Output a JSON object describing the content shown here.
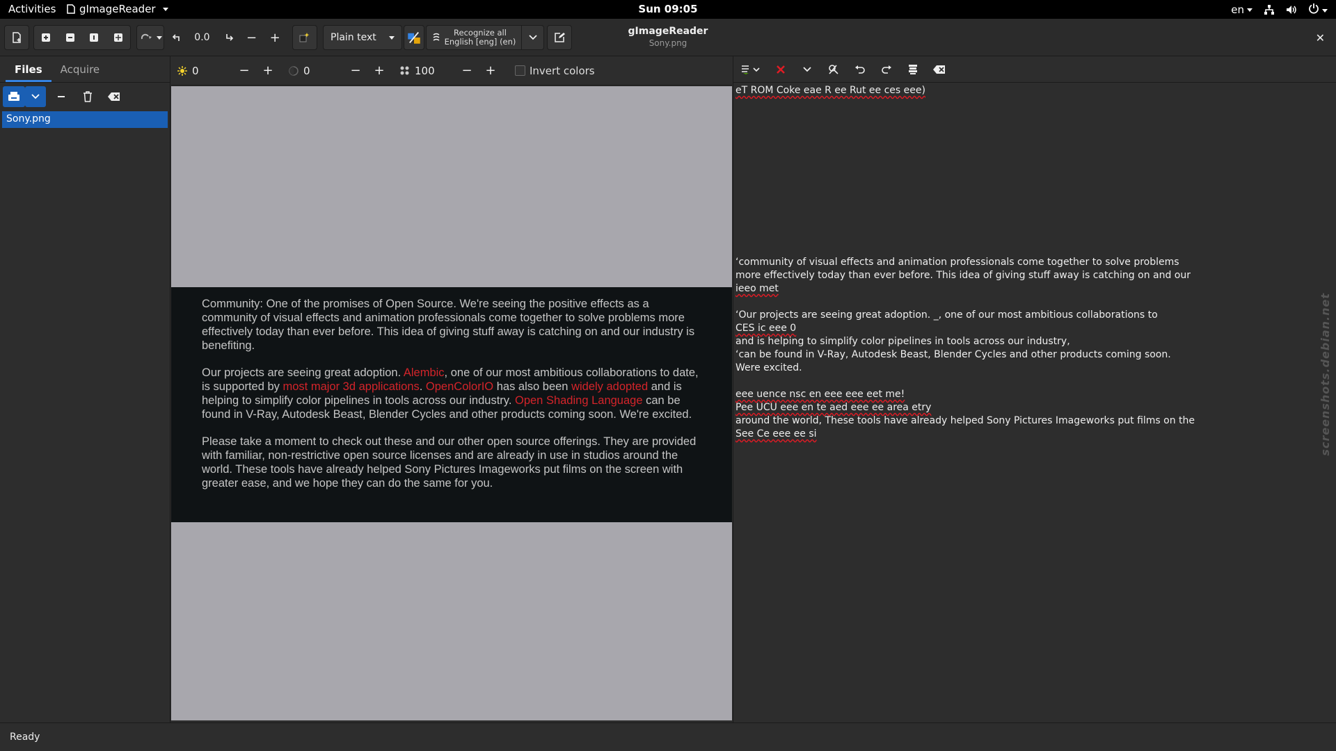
{
  "topbar": {
    "activities": "Activities",
    "app_name": "gImageReader",
    "clock": "Sun 09:05",
    "lang": "en"
  },
  "header": {
    "angle_value": "0.0",
    "output_mode": "Plain text",
    "recognize_line1": "Recognize all",
    "recognize_line2": "English [eng] (en)",
    "title": "gImageReader",
    "subtitle": "Sony.png",
    "close": "✕"
  },
  "left": {
    "tabs": [
      {
        "label": "Files"
      },
      {
        "label": "Acquire"
      }
    ],
    "files": [
      {
        "name": "Sony.png"
      }
    ]
  },
  "mid": {
    "brightness": "0",
    "contrast": "0",
    "resolution": "100",
    "minus": "−",
    "plus": "+",
    "invert_label": "Invert colors"
  },
  "doc": {
    "p1": "Community: One of the promises of Open Source. We're seeing the positive effects as a community of visual effects and animation professionals come together to solve problems more effectively today than ever before. This idea of giving stuff away is catching on and our industry is benefiting.",
    "p2_a": "Our projects are seeing great adoption. ",
    "p2_link1": "Alembic",
    "p2_b": ", one of our most ambitious collaborations to date, is supported by ",
    "p2_link2": "most major 3d applications",
    "p2_c": ". ",
    "p2_link3": "OpenColorIO",
    "p2_d": " has also been ",
    "p2_link4": "widely adopted",
    "p2_e": " and is helping to simplify color pipelines in tools across our industry. ",
    "p2_link5": "Open Shading Language",
    "p2_f": " can be found in V-Ray, Autodesk Beast, Blender Cycles and other products coming soon. We're excited.",
    "p3": "Please take a moment to check out these and our other open source offerings. They are provided with familiar, non-restrictive open source licenses and are already in use in studios around the world. These tools have already helped Sony Pictures Imageworks put films on the screen with greater ease, and we hope they can do the same for you."
  },
  "ocr": {
    "l1": "eT ROM Coke eae R ee Rut ee ces eee)",
    "l2": "‘community of visual effects and animation professionals come together to solve problems",
    "l3": "more effectively today than ever before. This idea of giving stuff away is catching on and our",
    "l4": "ieeo met",
    "l5": "‘Our projects are seeing great adoption. _, one of our most ambitious collaborations to",
    "l6": "CES ic eee 0",
    "l7": "and is helping to simplify color pipelines in tools across our industry,",
    "l8": "‘can be found in V-Ray, Autodesk Beast, Blender Cycles and other products coming soon.",
    "l9": "Were excited.",
    "l10": "eee uence nsc en eee eee eet me!",
    "l11": "Pee UCU eee en te aed eee ee area etry",
    "l12": "around the world, These tools have already helped Sony Pictures Imageworks put films on the",
    "l13": "See Ce eee ee si",
    "watermark": "screenshots.debian.net"
  },
  "status": {
    "text": "Ready"
  }
}
